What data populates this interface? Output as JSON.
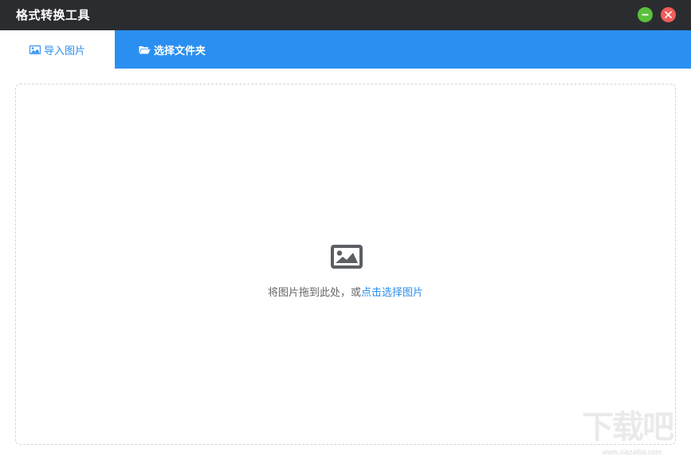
{
  "app": {
    "title": "格式转换工具"
  },
  "window_controls": {
    "minimize_icon": "minimize-icon",
    "close_icon": "close-icon",
    "minimize_color": "#5ac03c",
    "close_color": "#f05c59"
  },
  "tabs": [
    {
      "label": "导入图片",
      "icon": "image-icon",
      "active": true
    },
    {
      "label": "选择文件夹",
      "icon": "folder-open-icon",
      "active": false
    }
  ],
  "dropzone": {
    "icon": "image-icon",
    "text": "将图片拖到此处，或",
    "link_text": "点击选择图片"
  },
  "watermark": {
    "logo": "下载吧",
    "url": "www.xiazaiba.com"
  },
  "colors": {
    "titlebar": "#2b2c30",
    "accent": "#2a8ff0",
    "text_muted": "#666666"
  }
}
